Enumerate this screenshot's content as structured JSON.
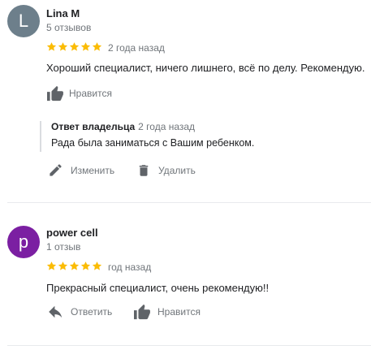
{
  "reviews": [
    {
      "author": "Lina M",
      "avatar_letter": "L",
      "avatar_color": "#6d7f8b",
      "review_count": "5 отзывов",
      "rating": 5,
      "date": "2 года назад",
      "text": "Хороший специалист, ничего лишнего, всё по делу. Рекомендую.",
      "like_label": "Нравится",
      "owner_reply": {
        "title": "Ответ владельца",
        "date": "2 года назад",
        "text": "Рада была заниматься с Вашим ребенком."
      },
      "edit_label": "Изменить",
      "delete_label": "Удалить"
    },
    {
      "author": "power cell",
      "avatar_letter": "p",
      "avatar_color": "#7b1fa2",
      "review_count": "1 отзыв",
      "rating": 5,
      "date": "год назад",
      "text": "Прекрасный специалист, очень рекомендую!!",
      "reply_label": "Ответить",
      "like_label": "Нравится"
    }
  ],
  "colors": {
    "star": "#fbbc04",
    "muted": "#70757a",
    "icon": "#5f6368"
  }
}
